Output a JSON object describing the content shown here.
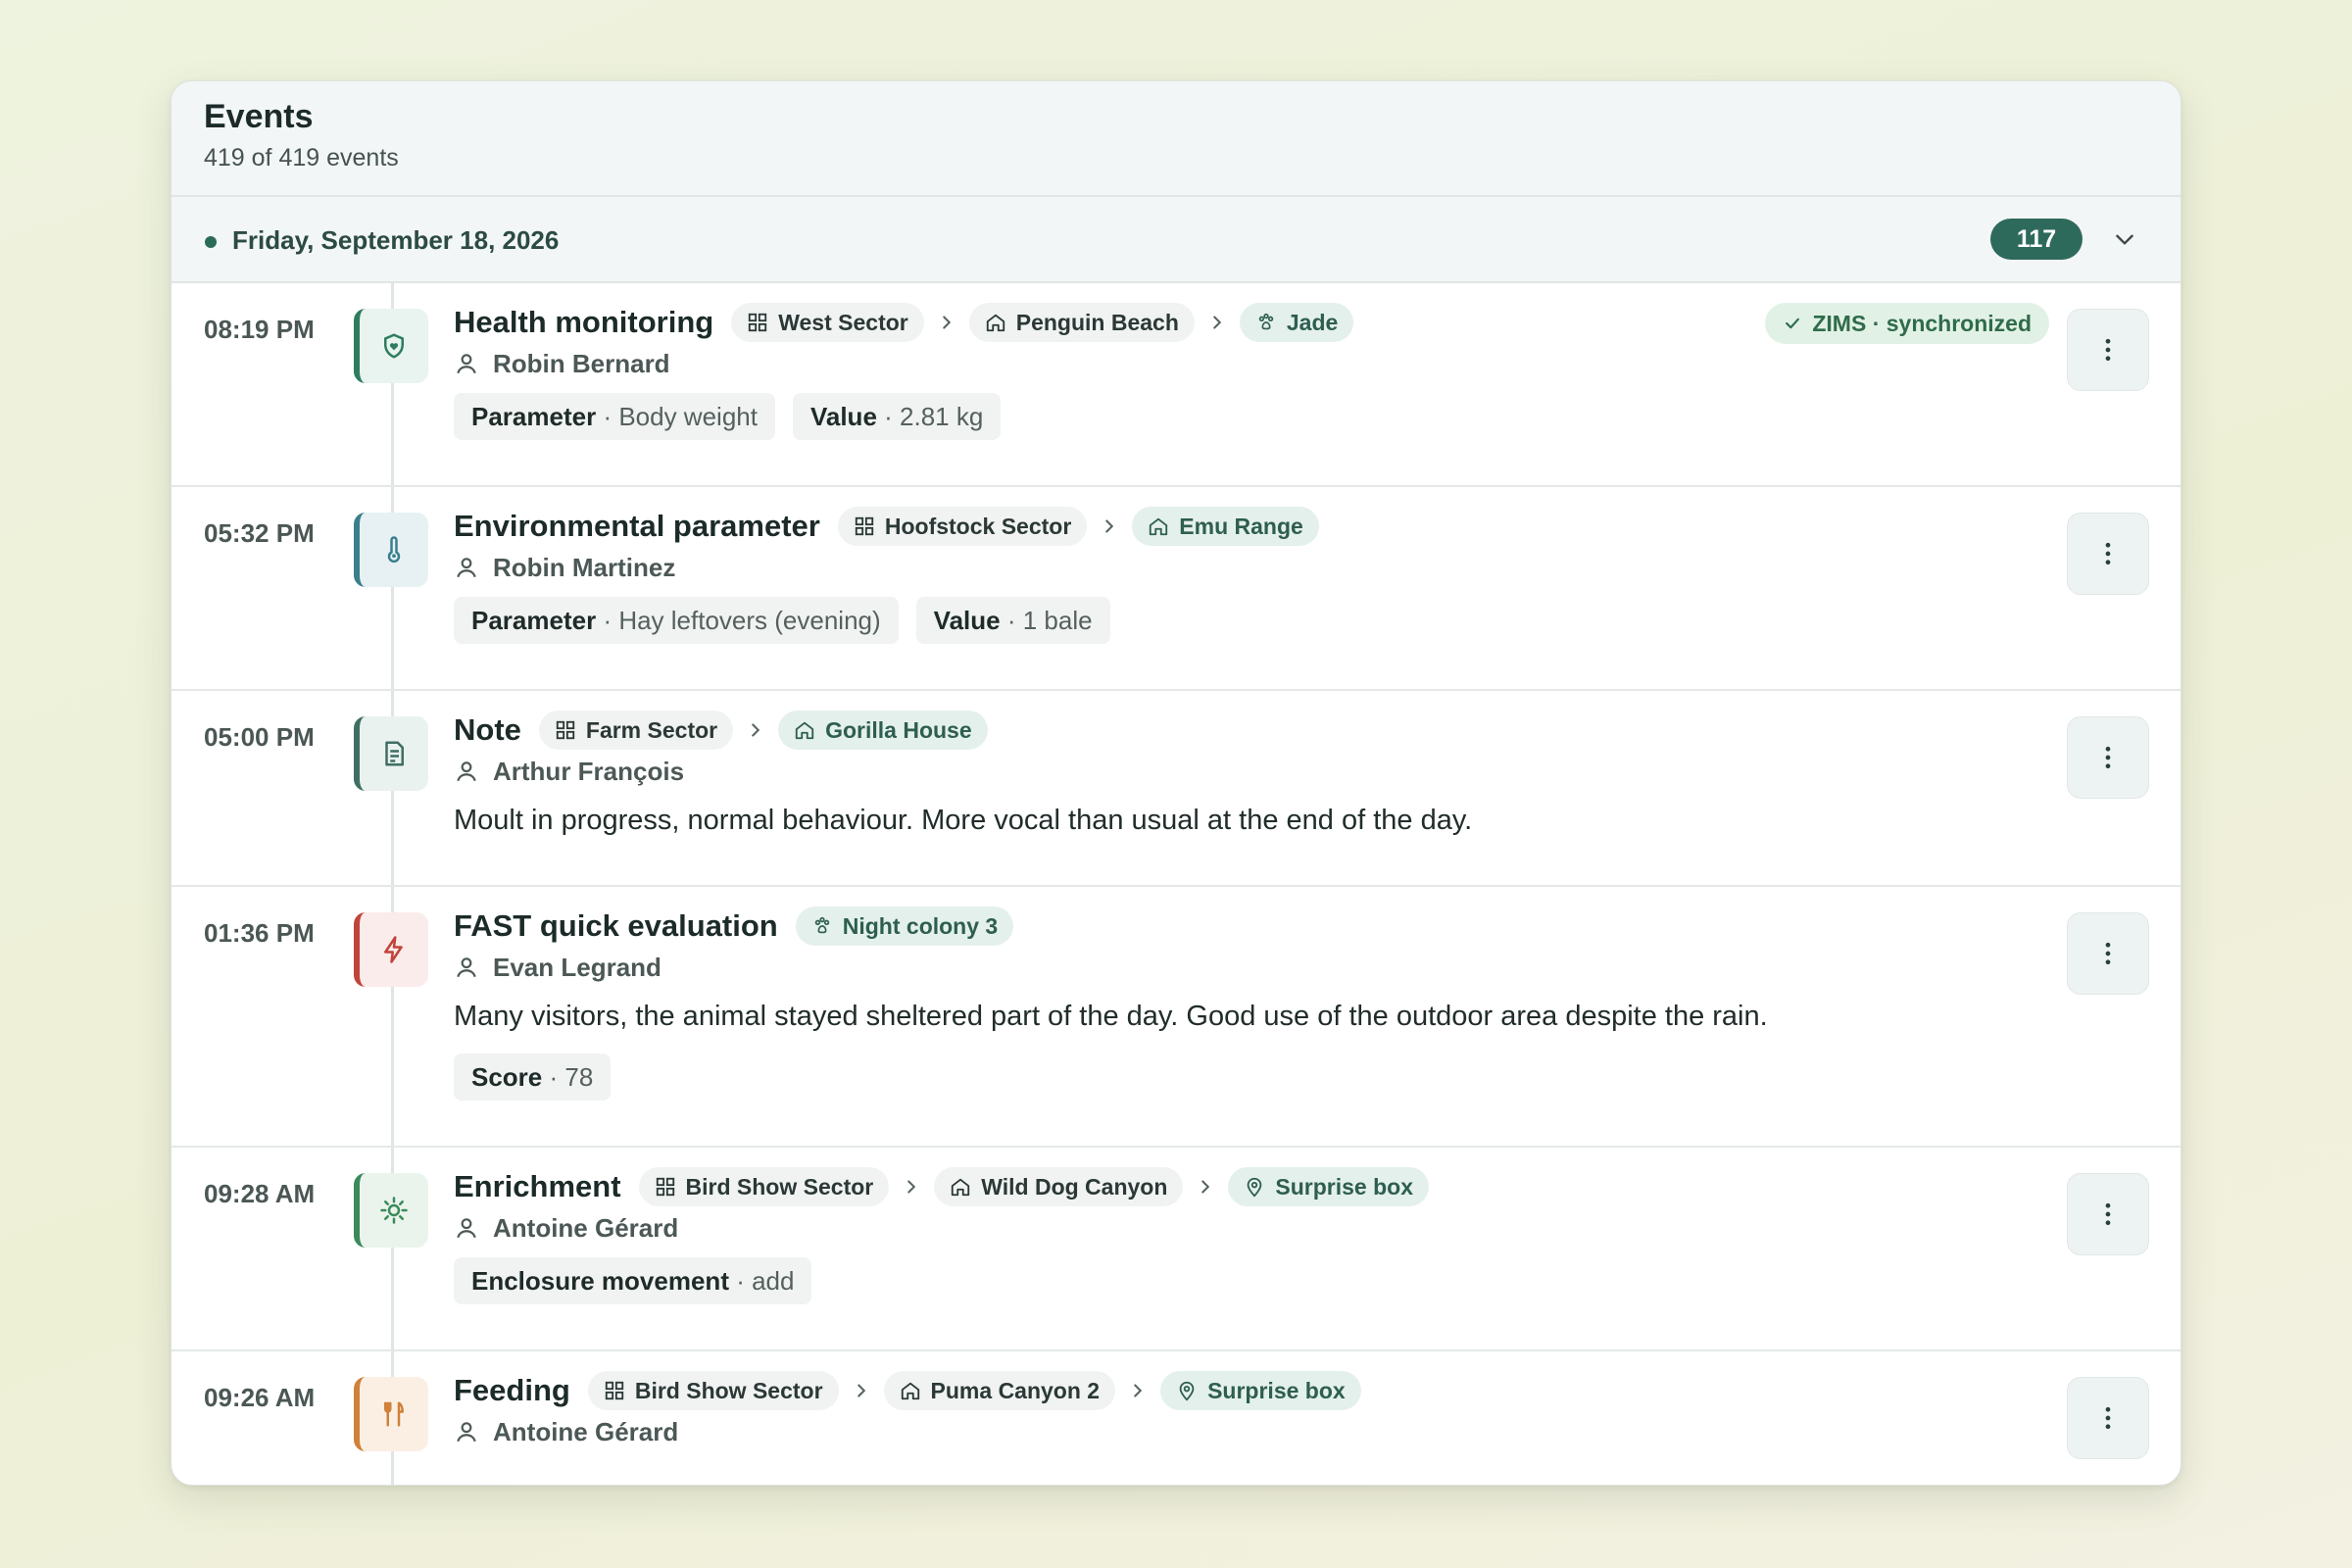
{
  "header": {
    "title": "Events",
    "subtitle": "419 of 419 events"
  },
  "day": {
    "label": "Friday, September 18, 2026",
    "count": "117"
  },
  "colors": {
    "accent": "#2e6a5b",
    "health": "#2e7d5f",
    "environment": "#3a7f8c",
    "note": "#3f6e62",
    "fast": "#c0443b",
    "enrichment": "#3b8a5a",
    "feeding": "#d0813a"
  },
  "events": [
    {
      "time": "08:19 PM",
      "icon": "heart-shield-icon",
      "title": "Health monitoring",
      "location": [
        "West Sector",
        "Penguin Beach"
      ],
      "animal": "Jade",
      "user": "Robin Bernard",
      "status": "ZIMS · synchronized",
      "tags": [
        {
          "label": "Parameter",
          "value": "· Body weight"
        },
        {
          "label": "Value",
          "value": "· 2.81 kg"
        }
      ]
    },
    {
      "time": "05:32 PM",
      "icon": "thermometer-icon",
      "title": "Environmental parameter",
      "location": [
        "Hoofstock Sector",
        "Emu Range"
      ],
      "user": "Robin Martinez",
      "tags": [
        {
          "label": "Parameter",
          "value": "· Hay leftovers (evening)"
        },
        {
          "label": "Value",
          "value": "· 1 bale"
        }
      ]
    },
    {
      "time": "05:00 PM",
      "icon": "note-icon",
      "title": "Note",
      "location": [
        "Farm Sector",
        "Gorilla House"
      ],
      "user": "Arthur François",
      "text": "Moult in progress, normal behaviour. More vocal than usual at the end of the day."
    },
    {
      "time": "01:36 PM",
      "icon": "lightning-icon",
      "title": "FAST quick evaluation",
      "animal": "Night colony 3",
      "user": "Evan Legrand",
      "text": "Many visitors, the animal stayed sheltered part of the day. Good use of the outdoor area despite the rain.",
      "tags": [
        {
          "label": "Score",
          "value": "· 78"
        }
      ]
    },
    {
      "time": "09:28 AM",
      "icon": "sun-icon",
      "title": "Enrichment",
      "location": [
        "Bird Show Sector",
        "Wild Dog Canyon"
      ],
      "spot": "Surprise box",
      "user": "Antoine Gérard",
      "tags": [
        {
          "label": "Enclosure movement",
          "value": "· add"
        }
      ]
    },
    {
      "time": "09:26 AM",
      "icon": "fork-knife-icon",
      "title": "Feeding",
      "location": [
        "Bird Show Sector",
        "Puma Canyon 2"
      ],
      "spot": "Surprise box",
      "user": "Antoine Gérard"
    }
  ]
}
